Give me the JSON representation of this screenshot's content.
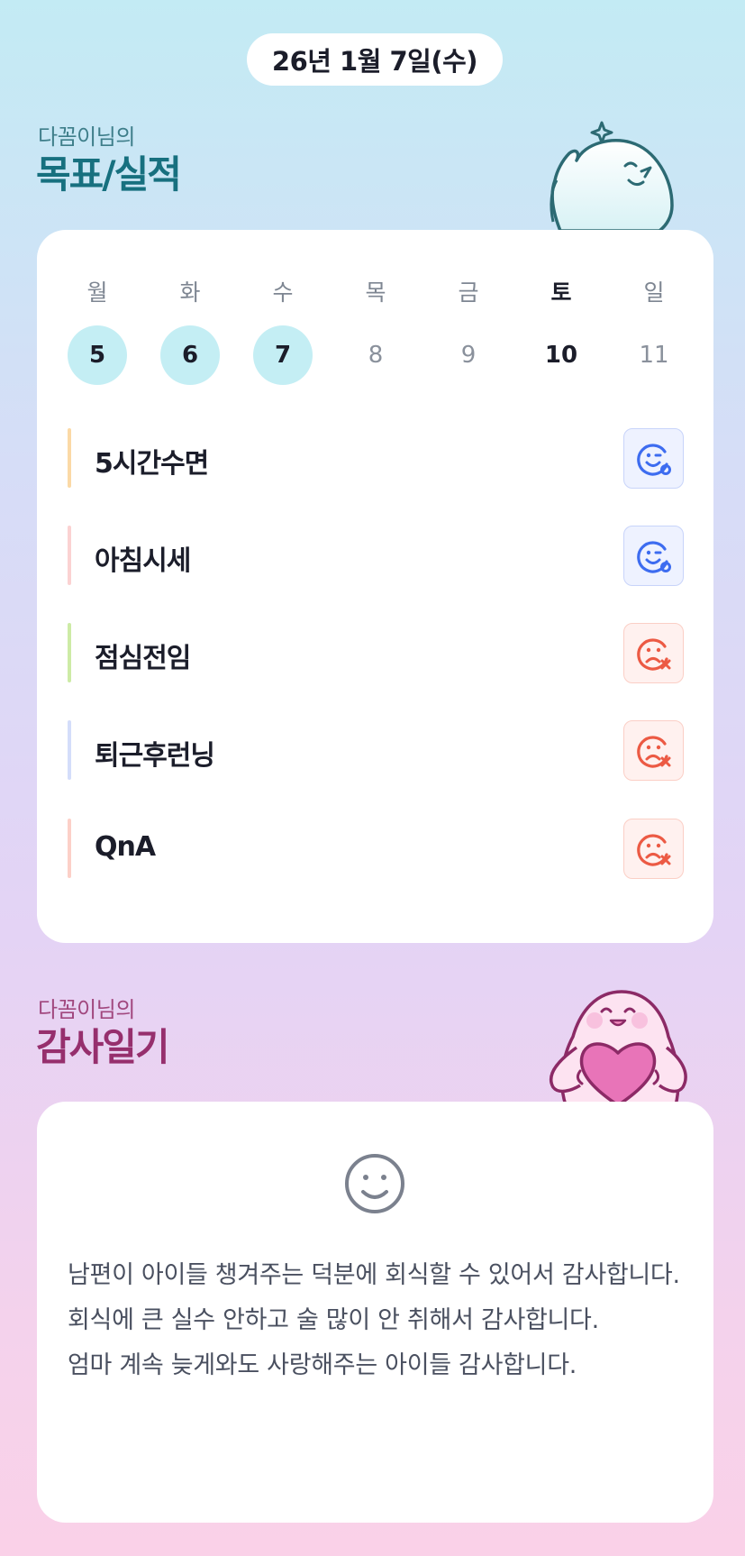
{
  "header": {
    "date": "26년 1월 7일(수)"
  },
  "goals_section": {
    "subtitle": "다꼼이님의",
    "title": "목표/실적"
  },
  "week": [
    {
      "day": "월",
      "date": "5",
      "state": "done"
    },
    {
      "day": "화",
      "date": "6",
      "state": "done"
    },
    {
      "day": "수",
      "date": "7",
      "state": "done"
    },
    {
      "day": "목",
      "date": "8",
      "state": "none"
    },
    {
      "day": "금",
      "date": "9",
      "state": "none"
    },
    {
      "day": "토",
      "date": "10",
      "state": "today"
    },
    {
      "day": "일",
      "date": "11",
      "state": "none"
    }
  ],
  "goals": [
    {
      "label": "5시간수면",
      "status": "success",
      "bar_color": "#fbd9a6",
      "icon": "smile-check-icon"
    },
    {
      "label": "아침시세",
      "status": "success",
      "bar_color": "#fbd2d2",
      "icon": "smile-check-icon"
    },
    {
      "label": "점심전임",
      "status": "fail",
      "bar_color": "#cdeba6",
      "icon": "sad-x-icon"
    },
    {
      "label": "퇴근후런닝",
      "status": "fail",
      "bar_color": "#d4ddfa",
      "icon": "sad-x-icon"
    },
    {
      "label": "QnA",
      "status": "fail",
      "bar_color": "#fcd0c8",
      "icon": "sad-x-icon"
    }
  ],
  "diary_section": {
    "subtitle": "다꼼이님의",
    "title": "감사일기"
  },
  "diary": {
    "mood_icon": "smile-face-icon",
    "lines": [
      "남편이 아이들 챙겨주는 덕분에 회식할 수 있어서 감사합니다.",
      "회식에 큰 실수 안하고 술 많이 안 취해서 감사합니다.",
      "엄마 계속 늦게와도 사랑해주는 아이들 감사합니다."
    ]
  },
  "colors": {
    "success_icon": "#3d6cf0",
    "fail_icon": "#ec5a44",
    "teal_title": "#17707f",
    "pink_title": "#962f6d"
  }
}
